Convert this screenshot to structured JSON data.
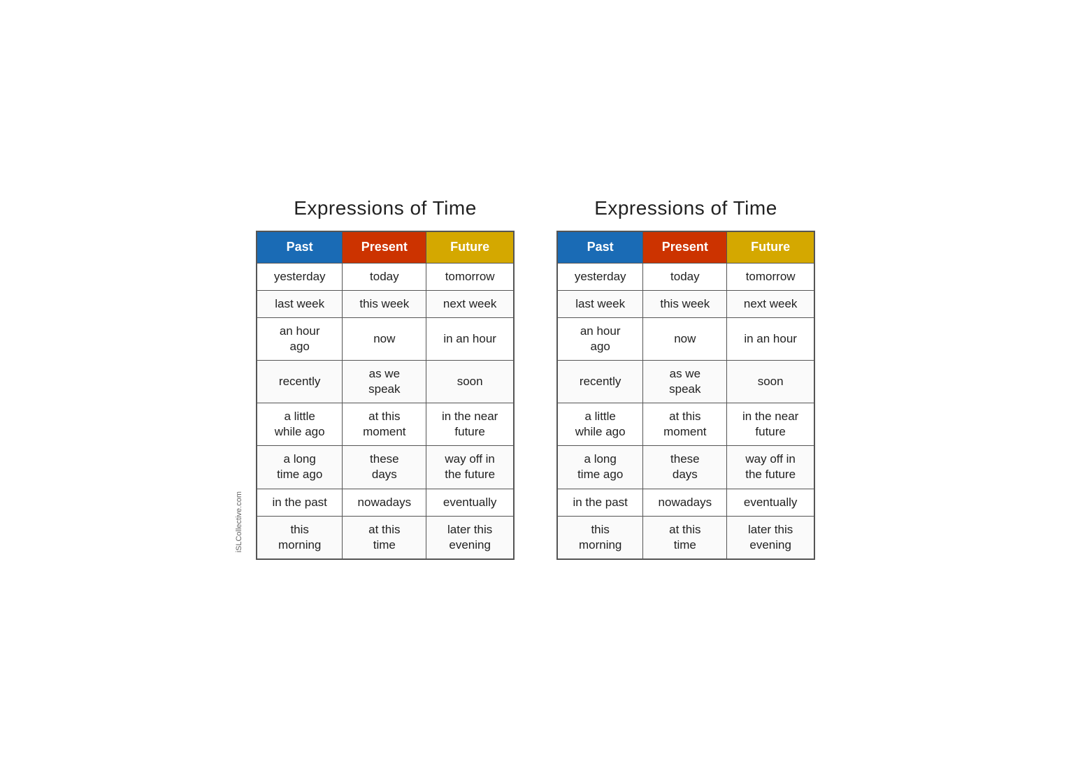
{
  "tables": [
    {
      "id": "table-left",
      "title": "Expressions of Time",
      "headers": {
        "past": "Past",
        "present": "Present",
        "future": "Future"
      },
      "rows": [
        {
          "past": "yesterday",
          "present": "today",
          "future": "tomorrow"
        },
        {
          "past": "last week",
          "present": "this week",
          "future": "next week"
        },
        {
          "past": "an hour\nago",
          "present": "now",
          "future": "in an hour"
        },
        {
          "past": "recently",
          "present": "as we\nspeak",
          "future": "soon"
        },
        {
          "past": "a little\nwhile ago",
          "present": "at this\nmoment",
          "future": "in the near\nfuture"
        },
        {
          "past": "a long\ntime ago",
          "present": "these\ndays",
          "future": "way off in\nthe future"
        },
        {
          "past": "in the past",
          "present": "nowadays",
          "future": "eventually"
        },
        {
          "past": "this\nmorning",
          "present": "at this\ntime",
          "future": "later this\nevening"
        }
      ]
    },
    {
      "id": "table-right",
      "title": "Expressions of Time",
      "headers": {
        "past": "Past",
        "present": "Present",
        "future": "Future"
      },
      "rows": [
        {
          "past": "yesterday",
          "present": "today",
          "future": "tomorrow"
        },
        {
          "past": "last week",
          "present": "this week",
          "future": "next week"
        },
        {
          "past": "an hour\nago",
          "present": "now",
          "future": "in an hour"
        },
        {
          "past": "recently",
          "present": "as we\nspeak",
          "future": "soon"
        },
        {
          "past": "a little\nwhile ago",
          "present": "at this\nmoment",
          "future": "in the near\nfuture"
        },
        {
          "past": "a long\ntime ago",
          "present": "these\ndays",
          "future": "way off in\nthe future"
        },
        {
          "past": "in the past",
          "present": "nowadays",
          "future": "eventually"
        },
        {
          "past": "this\nmorning",
          "present": "at this\ntime",
          "future": "later this\nevening"
        }
      ]
    }
  ],
  "watermark": "iSLCollective.com"
}
